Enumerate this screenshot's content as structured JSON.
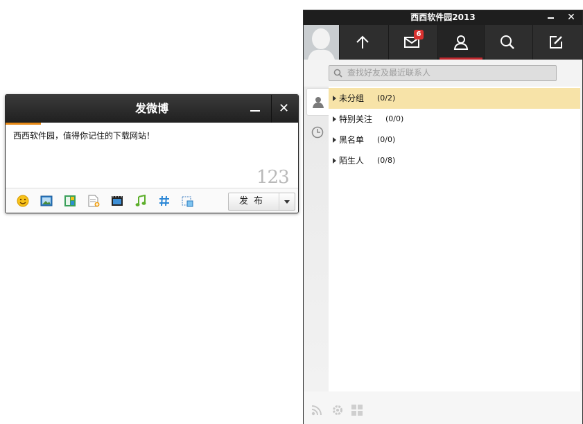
{
  "compose": {
    "title": "发微博",
    "text": "西西软件园，值得你记住的下载网站！",
    "counter": "123",
    "publish_label": "发布",
    "toolbar_icons": [
      "emoji-icon",
      "image-icon",
      "template-icon",
      "file-icon",
      "video-icon",
      "music-icon",
      "topic-icon",
      "screenshot-icon"
    ],
    "accent_color": "#e88a17"
  },
  "client": {
    "title": "西西软件园2013",
    "close_glyph": "✕",
    "nav_tabs": [
      "home-icon",
      "messages-icon",
      "contacts-icon",
      "search-icon",
      "compose-icon"
    ],
    "message_badge": "6",
    "search_placeholder": "查找好友及最近联系人",
    "side_tabs": [
      "contacts-icon",
      "recent-icon"
    ],
    "groups": [
      {
        "name": "未分组",
        "count": "(0/2)"
      },
      {
        "name": "特别关注",
        "count": "(0/0)"
      },
      {
        "name": "黑名单",
        "count": "(0/0)"
      },
      {
        "name": "陌生人",
        "count": "(0/8)"
      }
    ],
    "bottom_icons": [
      "rss-icon",
      "settings-icon",
      "apps-icon"
    ],
    "accent_color": "#c0282e"
  }
}
